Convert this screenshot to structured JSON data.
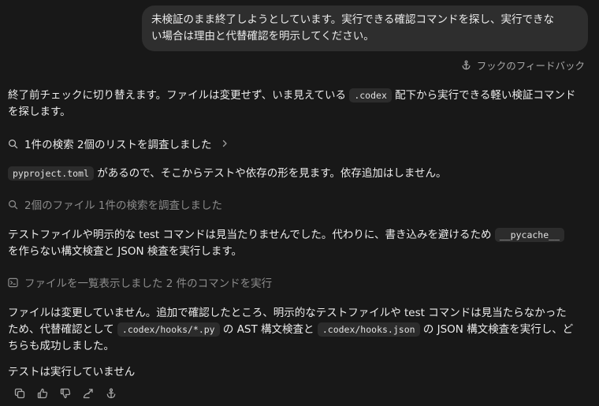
{
  "user_message": {
    "line1": "未検証のまま終了しようとしています。実行できる確認コマンドを探し、実行できな",
    "line2": "い場合は理由と代替確認を明示してください。"
  },
  "hook_feedback": {
    "label": "フックのフィードバック",
    "icon": "anchor-icon"
  },
  "assistant": {
    "p1": {
      "line1_pre": "終了前チェックに切り替えます。ファイルは変更せず、いま見えている",
      "line1_code": ".codex",
      "line1_post": "配下から実行できる軽い検証コマンド",
      "line2": "を探します。"
    },
    "step1": {
      "label": "1件の検索 2個のリストを調査しました",
      "icon": "search-icon"
    },
    "p2": {
      "code": "pyproject.toml",
      "text": "があるので、そこからテストや依存の形を見ます。依存追加はしません。"
    },
    "step2": {
      "label": "2個のファイル 1件の検索を調査しました",
      "icon": "search-icon"
    },
    "p3": {
      "line1_pre": "テストファイルや明示的な test コマンドは見当たりませんでした。代わりに、書き込みを避けるため",
      "line1_code": "__pycache__",
      "line2": "を作らない構文検査と JSON 検査を実行します。"
    },
    "step3": {
      "label": "ファイルを一覧表示しました 2 件のコマンドを実行",
      "icon": "terminal-icon"
    },
    "p4": {
      "line1": "ファイルは変更していません。追加で確認したところ、明示的なテストファイルや test コマンドは見当たらなかった",
      "line2_a": "ため、代替確認として",
      "line2_code1": ".codex/hooks/*.py",
      "line2_b": "の AST 構文検査と",
      "line2_code2": ".codex/hooks.json",
      "line2_c": "の JSON 構文検査を実行し、ど",
      "line3": "ちらも成功しました。"
    },
    "p5": "テストは実行していません"
  },
  "toolbar": {
    "icons": [
      "copy-icon",
      "thumbs-up-icon",
      "thumbs-down-icon",
      "share-icon",
      "anchor-icon"
    ]
  }
}
